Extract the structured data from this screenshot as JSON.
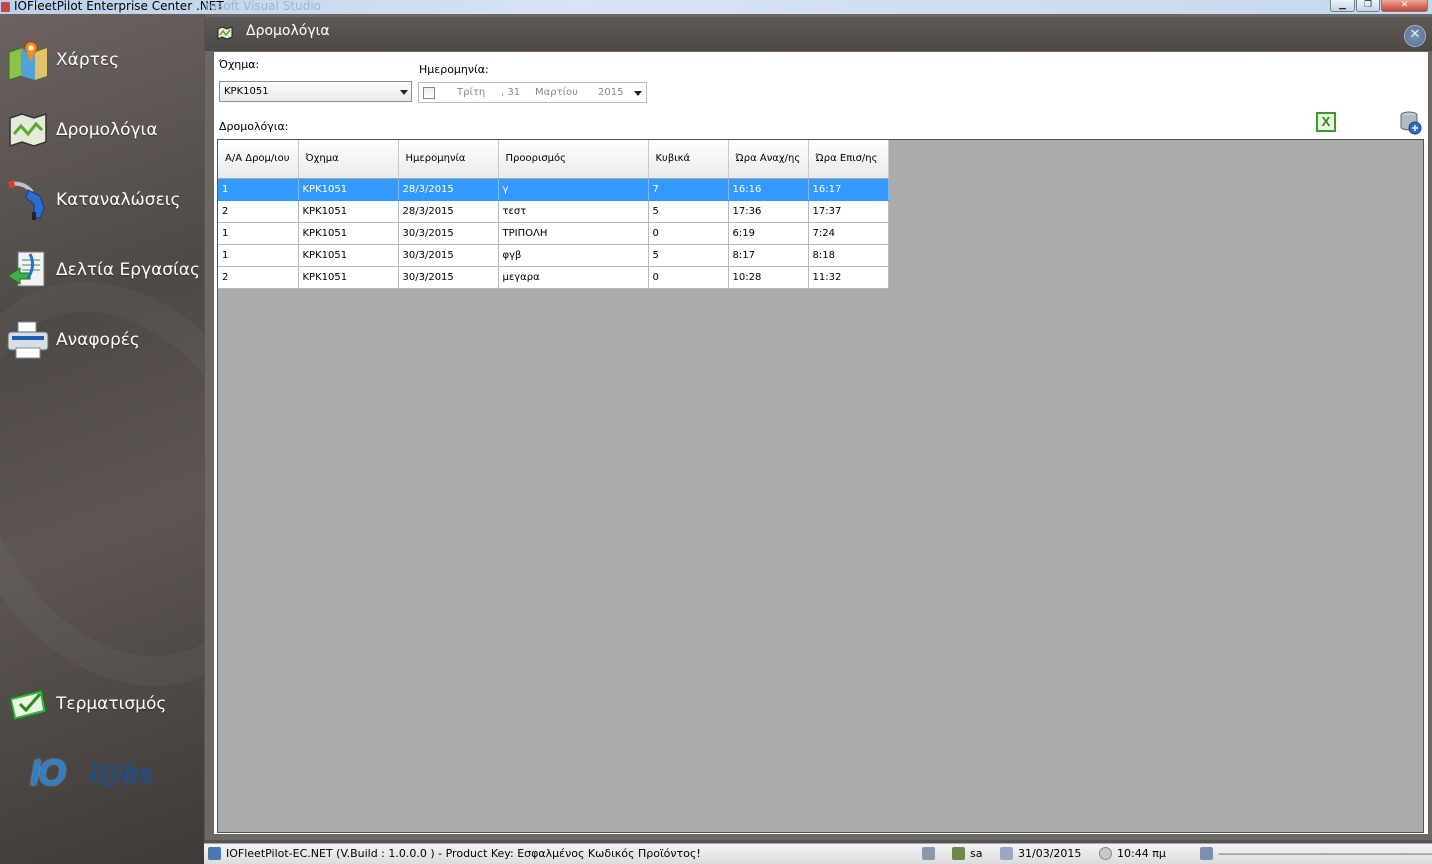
{
  "window": {
    "title": "IOFleetPilot Enterprise Center .NET",
    "ghost_title": "rosoft Visual Studio",
    "min_label": "▁",
    "max_label": "❐",
    "close_label": "✕"
  },
  "sidebar": {
    "items": [
      {
        "label": "Χάρτες",
        "icon": "map-icon"
      },
      {
        "label": "Δρομολόγια",
        "icon": "route-icon"
      },
      {
        "label": "Καταναλώσεις",
        "icon": "fuel-nozzle-icon"
      },
      {
        "label": "Δελτία Εργασίας",
        "icon": "work-sheet-icon"
      },
      {
        "label": "Αναφορές",
        "icon": "printer-icon"
      }
    ],
    "exit_label": "Τερματισμός",
    "logo_io": "IO",
    "logo_labs": "l@bs"
  },
  "panel": {
    "title": "Δρομολόγια",
    "close_label": "✕"
  },
  "filters": {
    "vehicle_label": "Όχημα:",
    "vehicle_value": "KPK1051",
    "date_label": "Ημερομηνία:",
    "date_weekday": "Τρίτη",
    "date_day": ", 31",
    "date_month": "Μαρτίου",
    "date_year": "2015",
    "routes_label": "Δρομολόγια:"
  },
  "toolbar": {
    "excel_label": "X"
  },
  "grid": {
    "columns": [
      "Α/Α Δρομ/ιου",
      "Όχημα",
      "Ημερομηνία",
      "Προορισμός",
      "Κυβικά",
      "Ώρα Αναχ/ης",
      "Ώρα Επισ/ης"
    ],
    "rows": [
      [
        "1",
        "KPK1051",
        "28/3/2015",
        "γ",
        "7",
        "16:16",
        "16:17"
      ],
      [
        "2",
        "KPK1051",
        "28/3/2015",
        "τεστ",
        "5",
        "17:36",
        "17:37"
      ],
      [
        "1",
        "KPK1051",
        "30/3/2015",
        "ΤΡΙΠΟΛΗ",
        "0",
        "6:19",
        "7:24"
      ],
      [
        "1",
        "KPK1051",
        "30/3/2015",
        "φγβ",
        "5",
        "8:17",
        "8:18"
      ],
      [
        "2",
        "KPK1051",
        "30/3/2015",
        "μεγαρα",
        "0",
        "10:28",
        "11:32"
      ]
    ],
    "selected_row": 0
  },
  "statusbar": {
    "app_info": "IOFleetPilot-EC.NET (V.Build : 1.0.0.0 ) - Product Key: Εσφαλμένος Κωδικός Προϊόντος!",
    "user": "sa",
    "date": "31/03/2015",
    "time": "10:44 πμ",
    "dashes": "----------------------------------------------------------------------------"
  },
  "colors": {
    "selection": "#3399ff",
    "sidebar": "#5a5450",
    "grid_background": "#ababab"
  }
}
